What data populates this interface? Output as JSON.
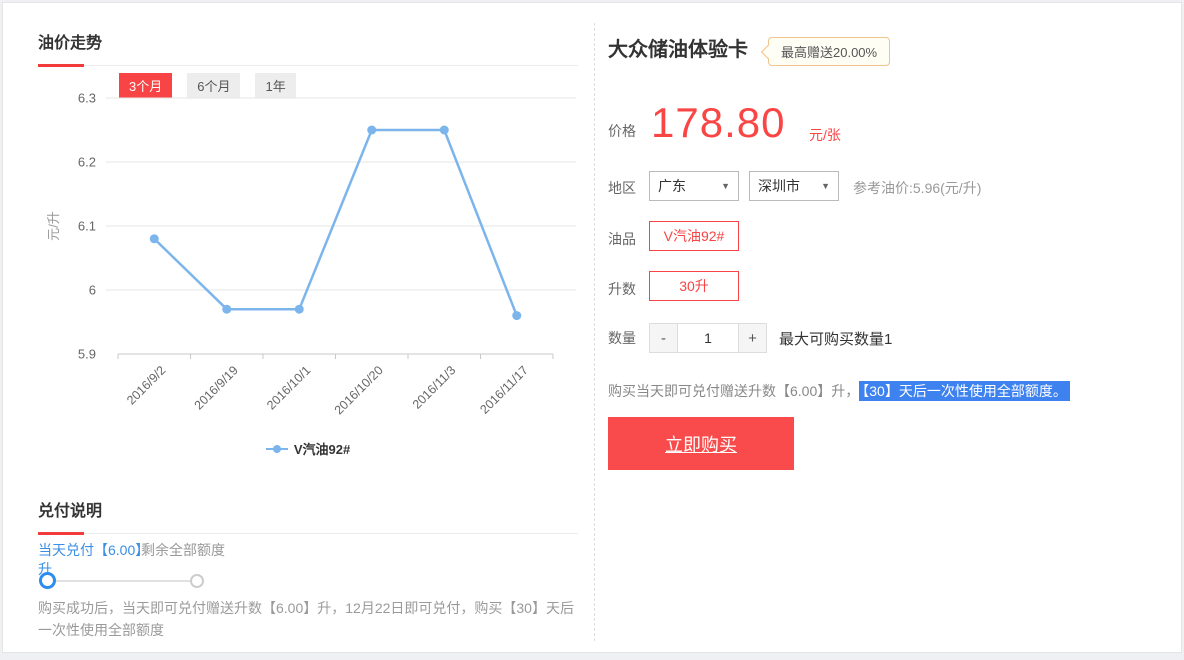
{
  "colors": {
    "accent_red": "#f84444",
    "underline_red": "#f23c3c",
    "series_blue": "#7cb5ec",
    "link_blue": "#3a8ee6",
    "handle_blue": "#2d8cf0",
    "highlight_blue": "#3e82f0",
    "badge_border": "#f0c48c"
  },
  "left": {
    "trend_section": {
      "title": "油价走势",
      "tabs": [
        {
          "label": "3个月",
          "active": true
        },
        {
          "label": "6个月",
          "active": false
        },
        {
          "label": "1年",
          "active": false
        }
      ]
    },
    "redeem_section": {
      "title": "兑付说明",
      "slider_left_label_line1": "当天兑付【6.00】",
      "slider_left_label_line2": "升",
      "slider_right_label": "剩余全部额度",
      "description": "购买成功后，当天即可兑付赠送升数【6.00】升，12月22日即可兑付，购买【30】天后一次性使用全部额度"
    }
  },
  "chart_data": {
    "type": "line",
    "categories": [
      "2016/9/2",
      "2016/9/19",
      "2016/10/1",
      "2016/10/20",
      "2016/11/3",
      "2016/11/17"
    ],
    "series": [
      {
        "name": "V汽油92#",
        "values": [
          6.08,
          5.97,
          5.97,
          6.25,
          6.25,
          5.96
        ],
        "color": "#7cb5ec"
      }
    ],
    "title": "",
    "xlabel": "",
    "ylabel": "元/升",
    "ylim": [
      5.9,
      6.3
    ],
    "yticks": [
      5.9,
      6,
      6.1,
      6.2,
      6.3
    ],
    "grid": true,
    "legend_position": "bottom"
  },
  "product": {
    "title": "大众储油体验卡",
    "badge": "最高赠送20.00%",
    "price_label": "价格",
    "price": "178.80",
    "price_unit": "元/张",
    "region_label": "地区",
    "province": "广东",
    "city": "深圳市",
    "reference_price": "参考油价:5.96(元/升)",
    "oil_label": "油品",
    "oil_type": "V汽油92#",
    "liters_label": "升数",
    "liters": "30升",
    "qty_label": "数量",
    "qty_minus": "-",
    "qty_value": "1",
    "qty_plus": "+",
    "max_qty_note": "最大可购买数量1",
    "promo_plain": "购买当天即可兑付赠送升数【6.00】升，",
    "promo_highlight": "【30】天后一次性使用全部额度。",
    "buy_button": "立即购买"
  },
  "icons": {
    "caret_down": "▼"
  }
}
